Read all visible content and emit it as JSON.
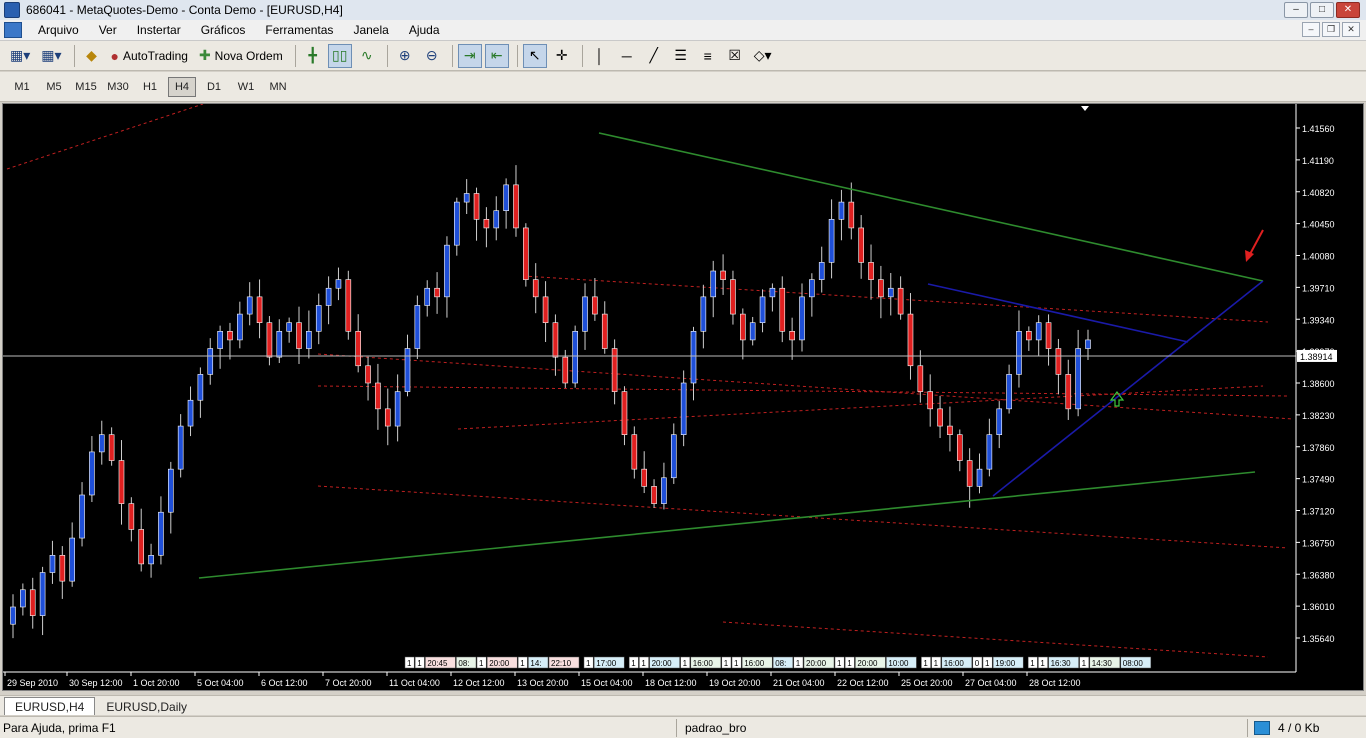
{
  "window": {
    "title": "686041 - MetaQuotes-Demo - Conta Demo - [EURUSD,H4]"
  },
  "menu": [
    "Arquivo",
    "Ver",
    "Instertar",
    "Gráficos",
    "Ferramentas",
    "Janela",
    "Ajuda"
  ],
  "toolbar": {
    "autotrading_label": "AutoTrading",
    "new_order_label": "Nova Ordem"
  },
  "timeframes": {
    "items": [
      "M1",
      "M5",
      "M15",
      "M30",
      "H1",
      "H4",
      "D1",
      "W1",
      "MN"
    ],
    "selected": "H4"
  },
  "chart": {
    "symbol": "EURUSD",
    "timeframe": "H4",
    "price_labels": [
      "1.41560",
      "1.41190",
      "1.40820",
      "1.40450",
      "1.40080",
      "1.39710",
      "1.39340",
      "1.38970",
      "1.38600",
      "1.38230",
      "1.37860",
      "1.37490",
      "1.37120",
      "1.36750",
      "1.36380",
      "1.36010",
      "1.35640"
    ],
    "current_price": "1.38914",
    "time_labels": [
      "29 Sep 2010",
      "30 Sep 12:00",
      "1 Oct 20:00",
      "5 Oct 04:00",
      "6 Oct 12:00",
      "7 Oct 20:00",
      "11 Oct 04:00",
      "12 Oct 12:00",
      "13 Oct 20:00",
      "15 Oct 04:00",
      "18 Oct 12:00",
      "19 Oct 20:00",
      "21 Oct 04:00",
      "22 Oct 12:00",
      "25 Oct 20:00",
      "27 Oct 04:00",
      "28 Oct 12:00"
    ],
    "event_labels": [
      "1",
      "1",
      "20:45",
      "08:",
      "1",
      "20:00",
      "1",
      "14:",
      "22:10",
      "1",
      "17:00",
      "1",
      "1",
      "20:00",
      "1",
      "16:00",
      "1",
      "1",
      "16:00",
      "08:",
      "1",
      "20:00",
      "1",
      "1",
      "20:00",
      "10:00",
      "1",
      "1",
      "16:00",
      "0",
      "1",
      "19:00",
      "1",
      "1",
      "16:30",
      "1",
      "14:30",
      "08:00"
    ],
    "colors": {
      "background": "#000000",
      "bull": "#1f4fd8",
      "bear": "#e02020",
      "trend_green": "#2e8b2e",
      "trend_blue": "#1a1aa8",
      "dotted_red": "#c02020"
    }
  },
  "tabs": [
    {
      "label": "EURUSD,H4",
      "active": true
    },
    {
      "label": "EURUSD,Daily",
      "active": false
    }
  ],
  "status": {
    "help": "Para Ajuda, prima F1",
    "profile": "padrao_bro",
    "connection": "4 / 0 Kb"
  }
}
